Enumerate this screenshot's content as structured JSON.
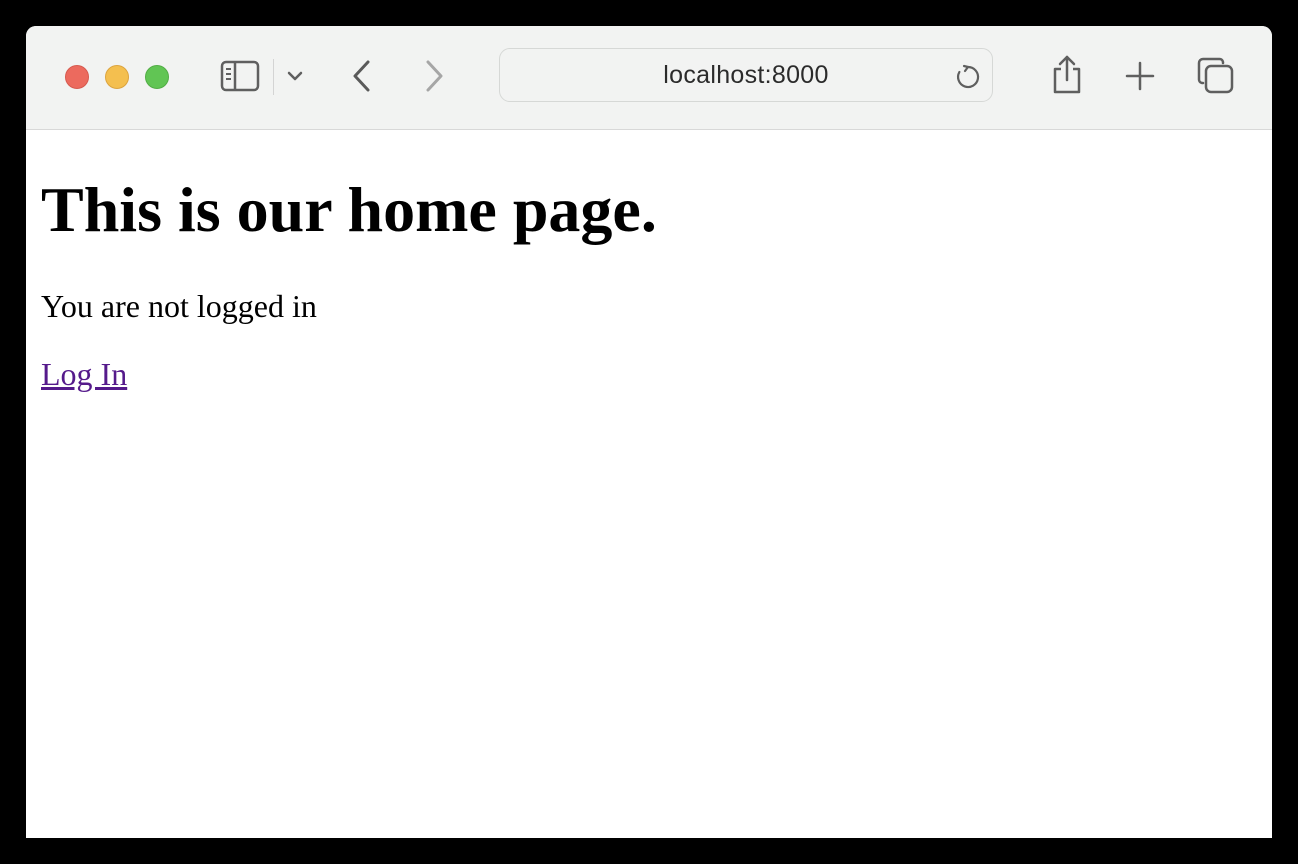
{
  "browser": {
    "url": "localhost:8000",
    "toolbar_icons": [
      "sidebar-icon",
      "chevron-down-icon",
      "back-icon",
      "forward-icon",
      "reload-icon",
      "share-icon",
      "new-tab-icon",
      "tab-overview-icon"
    ],
    "traffic_lights": {
      "close": "#ec6a5e",
      "minimize": "#f4bf4f",
      "zoom": "#61c554"
    }
  },
  "page": {
    "heading": "This is our home page.",
    "status": "You are not logged in",
    "login_link": "Log In",
    "link_color": "#551a8b"
  }
}
